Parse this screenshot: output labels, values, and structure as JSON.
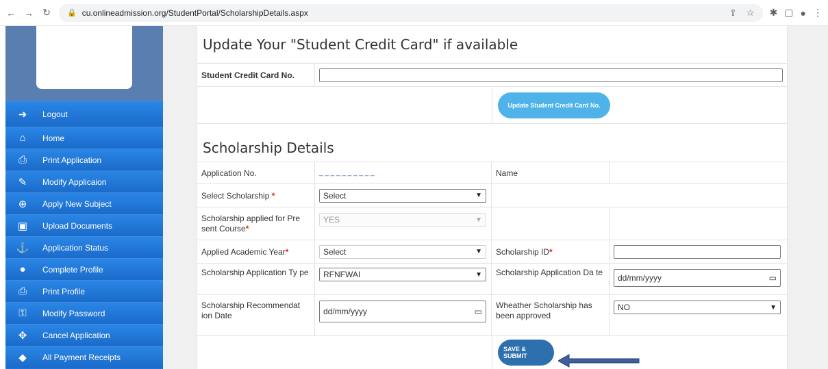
{
  "browser": {
    "url": "cu.onlineadmission.org/StudentPortal/ScholarshipDetails.aspx"
  },
  "sidebar": {
    "items": [
      {
        "label": "Logout",
        "icon": "logout-icon"
      },
      {
        "label": "Home",
        "icon": "home-icon"
      },
      {
        "label": "Print Application",
        "icon": "printer-icon"
      },
      {
        "label": "Modify Applicaion",
        "icon": "edit-icon"
      },
      {
        "label": "Apply New Subject",
        "icon": "plus-circle-icon"
      },
      {
        "label": "Upload Documents",
        "icon": "image-icon"
      },
      {
        "label": "Application Status",
        "icon": "anchor-icon"
      },
      {
        "label": "Complete Profile",
        "icon": "user-icon"
      },
      {
        "label": "Print Profile",
        "icon": "printer-icon"
      },
      {
        "label": "Modify Password",
        "icon": "key-icon"
      },
      {
        "label": "Cancel Application",
        "icon": "crosshair-icon"
      },
      {
        "label": "All Payment Receipts",
        "icon": "tag-icon"
      }
    ]
  },
  "credit_card": {
    "title": "Update Your \"Student Credit Card\" if available",
    "field_label": "Student Credit Card No.",
    "field_value": "",
    "button_label": "Update Student Credit Card No."
  },
  "scholarship": {
    "title": "Scholarship Details",
    "application_no_label": "Application No.",
    "application_no_value": "_ _ _ _ _ _ _ _ _ _",
    "name_label": "Name",
    "name_value": "",
    "select_scholarship_label": "Select Scholarship",
    "select_scholarship_value": "Select",
    "applied_present_label": "Scholarship applied for Pre sent Course",
    "applied_present_value": "YES",
    "academic_year_label": "Applied Academic Year",
    "academic_year_value": "Select",
    "scholarship_id_label": "Scholarship ID",
    "scholarship_id_value": "",
    "app_type_label": "Scholarship Application Ty pe",
    "app_type_value": "RFNFWAI",
    "app_date_label": "Scholarship Application Da te",
    "app_date_placeholder": "dd/mm/yyyy",
    "rec_date_label": "Scholarship Recommendat ion Date",
    "rec_date_placeholder": "dd/mm/yyyy",
    "approved_label": "Wheather Scholarship has been approved",
    "approved_value": "NO",
    "required_mark": "*",
    "submit_label": "SAVE & SUBMIT"
  },
  "colors": {
    "sidebar": "#1f73d8",
    "button": "#4fb3e9",
    "button_dark": "#2e6fae",
    "required": "#e0221a"
  }
}
